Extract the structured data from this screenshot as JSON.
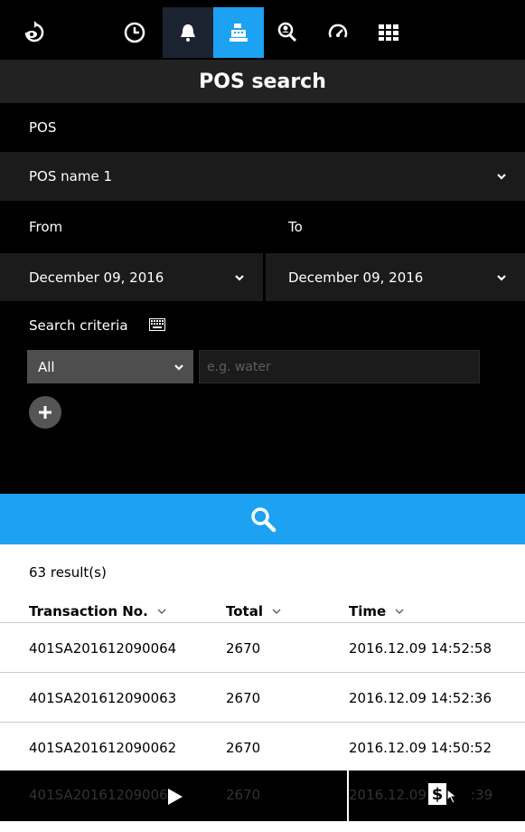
{
  "toolbar": {
    "icons": [
      "back-rotate-icon",
      "clock-icon",
      "bell-icon",
      "cash-register-icon",
      "search-person-icon",
      "gauge-icon",
      "grid-icon"
    ]
  },
  "header": {
    "title": "POS search"
  },
  "pos": {
    "label": "POS",
    "selected": "POS name 1"
  },
  "date": {
    "from_label": "From",
    "to_label": "To",
    "from_value": "December 09, 2016",
    "to_value": "December 09, 2016"
  },
  "criteria": {
    "label": "Search criteria",
    "select_value": "All",
    "placeholder": "e.g. water"
  },
  "results": {
    "count_text": "63 result(s)",
    "columns": [
      "Transaction No.",
      "Total",
      "Time"
    ],
    "rows": [
      {
        "txn": "401SA201612090064",
        "total": "2670",
        "time": "2016.12.09 14:52:58"
      },
      {
        "txn": "401SA201612090063",
        "total": "2670",
        "time": "2016.12.09 14:52:36"
      },
      {
        "txn": "401SA201612090062",
        "total": "2670",
        "time": "2016.12.09 14:50:52"
      }
    ],
    "partial_row": {
      "txn": "401SA20161209006",
      "total": "2670",
      "time_prefix": "2016.12.09",
      "time_suffix": ":39"
    }
  },
  "colors": {
    "accent": "#1da1f2",
    "header_bg": "#222222",
    "select_bg": "#1b1b1b"
  }
}
